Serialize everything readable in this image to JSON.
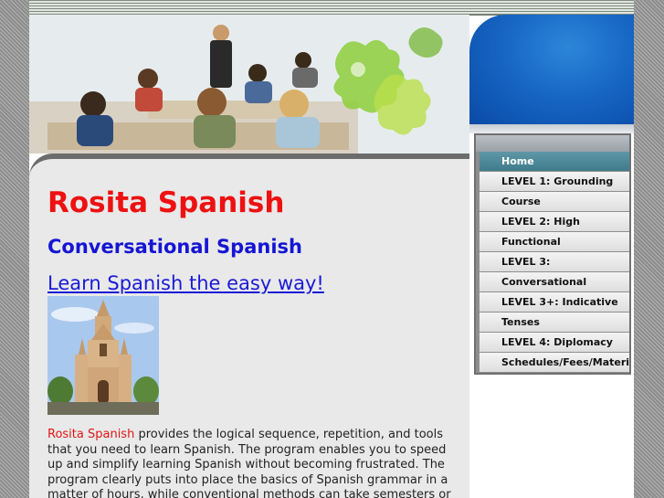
{
  "site": {
    "title": "Rosita Spanish",
    "subtitle": "Conversational Spanish",
    "tagline_link": "Learn Spanish the easy way!"
  },
  "nav": {
    "items": [
      {
        "label": "Home",
        "active": true
      },
      {
        "label": "LEVEL 1: Grounding",
        "active": false
      },
      {
        "label": "Course",
        "active": false
      },
      {
        "label": "LEVEL 2: High",
        "active": false
      },
      {
        "label": "Functional",
        "active": false
      },
      {
        "label": "LEVEL 3:",
        "active": false
      },
      {
        "label": "Conversational",
        "active": false
      },
      {
        "label": "LEVEL 3+: Indicative",
        "active": false
      },
      {
        "label": "Tenses",
        "active": false
      },
      {
        "label": "LEVEL 4: Diplomacy",
        "active": false
      },
      {
        "label": "Schedules/Fees/Materials",
        "active": false
      }
    ]
  },
  "description": {
    "highlight": "Rosita Spanish",
    "text": " provides the logical sequence, repetition, and tools that you need to learn Spanish. The program enables you to speed up and simplify learning Spanish without becoming frustrated. The program clearly puts into place the basics of Spanish grammar in a matter of hours, while conventional methods can take semesters or years."
  },
  "colors": {
    "title_red": "#ee1111",
    "subtitle_blue": "#1515d4",
    "nav_active": "#4a8797",
    "content_bg": "#e9e9e9"
  }
}
